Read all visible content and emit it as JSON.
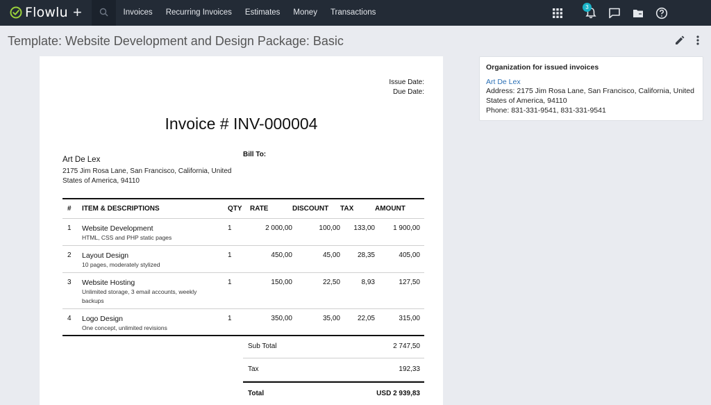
{
  "app": {
    "name": "Flowlu"
  },
  "nav": [
    "Invoices",
    "Recurring Invoices",
    "Estimates",
    "Money",
    "Transactions"
  ],
  "notifications": {
    "count": "3"
  },
  "page": {
    "title": "Template:  Website Development and Design Package: Basic"
  },
  "invoice": {
    "issue_date_label": "Issue Date:",
    "due_date_label": "Due Date:",
    "title": "Invoice # INV-000004",
    "org_name": "Art De Lex",
    "org_address": "2175 Jim Rosa Lane, San Francisco, California, United States of America, 94110",
    "bill_to_label": "Bill To:",
    "columns": {
      "num": "#",
      "item": "ITEM & DESCRIPTIONS",
      "qty": "QTY",
      "rate": "RATE",
      "discount": "DISCOUNT",
      "tax": "TAX",
      "amount": "AMOUNT"
    },
    "items": [
      {
        "num": "1",
        "name": "Website Development",
        "desc": "HTML, CSS and PHP static pages",
        "qty": "1",
        "rate": "2 000,00",
        "discount": "100,00",
        "tax": "133,00",
        "amount": "1 900,00"
      },
      {
        "num": "2",
        "name": "Layout Design",
        "desc": "10 pages, moderately stylized",
        "qty": "1",
        "rate": "450,00",
        "discount": "45,00",
        "tax": "28,35",
        "amount": "405,00"
      },
      {
        "num": "3",
        "name": "Website Hosting",
        "desc": "Unlimited storage, 3 email accounts, weekly backups",
        "qty": "1",
        "rate": "150,00",
        "discount": "22,50",
        "tax": "8,93",
        "amount": "127,50"
      },
      {
        "num": "4",
        "name": "Logo Design",
        "desc": "One concept, unlimited revisions",
        "qty": "1",
        "rate": "350,00",
        "discount": "35,00",
        "tax": "22,05",
        "amount": "315,00"
      }
    ],
    "subtotal_label": "Sub Total",
    "subtotal": "2 747,50",
    "tax_label": "Tax",
    "tax": "192,33",
    "total_label": "Total",
    "total": "USD 2 939,83"
  },
  "side_panel": {
    "title": "Organization for issued invoices",
    "org_link": "Art De Lex",
    "address": "Address: 2175 Jim Rosa Lane, San Francisco, California, United States of America, 94110",
    "phone": "Phone: 831-331-9541, 831-331-9541"
  }
}
